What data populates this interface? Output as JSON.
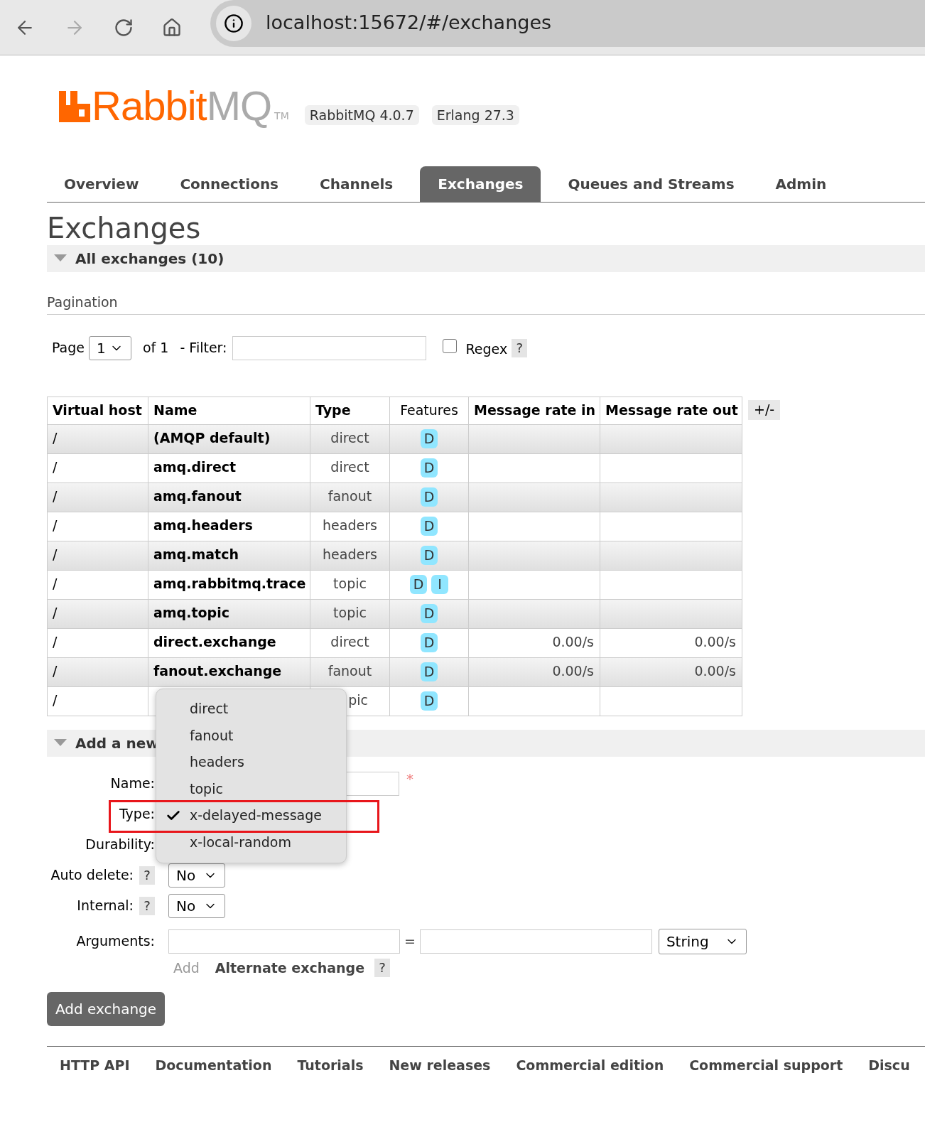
{
  "browser": {
    "url": "localhost:15672/#/exchanges"
  },
  "header": {
    "logo_primary": "Rabbit",
    "logo_secondary": "MQ",
    "trademark": "TM",
    "versions": [
      "RabbitMQ 4.0.7",
      "Erlang 27.3"
    ]
  },
  "tabs": [
    {
      "label": "Overview",
      "selected": false
    },
    {
      "label": "Connections",
      "selected": false
    },
    {
      "label": "Channels",
      "selected": false
    },
    {
      "label": "Exchanges",
      "selected": true
    },
    {
      "label": "Queues and Streams",
      "selected": false
    },
    {
      "label": "Admin",
      "selected": false
    }
  ],
  "page_title": "Exchanges",
  "all_section": {
    "title": "All exchanges (10)",
    "expanded": true
  },
  "pagination": {
    "heading": "Pagination",
    "page_label": "Page",
    "page_value": "1",
    "of_label": "of 1",
    "filter_label": "- Filter:",
    "regex_label": "Regex",
    "regex_checked": false,
    "help": "?"
  },
  "table": {
    "columns": [
      {
        "label": "Virtual host",
        "bold": true
      },
      {
        "label": "Name",
        "bold": true
      },
      {
        "label": "Type",
        "bold": true
      },
      {
        "label": "Features",
        "bold": false
      },
      {
        "label": "Message rate in",
        "bold": true
      },
      {
        "label": "Message rate out",
        "bold": true
      }
    ],
    "toggle": "+/-",
    "rows": [
      {
        "vhost": "/",
        "name": "(AMQP default)",
        "type": "direct",
        "features": [
          "D"
        ]
      },
      {
        "vhost": "/",
        "name": "amq.direct",
        "type": "direct",
        "features": [
          "D"
        ]
      },
      {
        "vhost": "/",
        "name": "amq.fanout",
        "type": "fanout",
        "features": [
          "D"
        ]
      },
      {
        "vhost": "/",
        "name": "amq.headers",
        "type": "headers",
        "features": [
          "D"
        ]
      },
      {
        "vhost": "/",
        "name": "amq.match",
        "type": "headers",
        "features": [
          "D"
        ]
      },
      {
        "vhost": "/",
        "name": "amq.rabbitmq.trace",
        "type": "topic",
        "features": [
          "D",
          "I"
        ]
      },
      {
        "vhost": "/",
        "name": "amq.topic",
        "type": "topic",
        "features": [
          "D"
        ]
      },
      {
        "vhost": "/",
        "name": "direct.exchange",
        "type": "direct",
        "features": [
          "D"
        ],
        "rate_in": "0.00/s",
        "rate_out": "0.00/s"
      },
      {
        "vhost": "/",
        "name": "fanout.exchange",
        "type": "fanout",
        "features": [
          "D"
        ],
        "rate_in": "0.00/s",
        "rate_out": "0.00/s"
      },
      {
        "vhost": "/",
        "type": "pic",
        "features": [
          "D"
        ]
      }
    ]
  },
  "add_section": {
    "title": "Add a new",
    "expanded": true
  },
  "form": {
    "name_label": "Name:",
    "required_mark": "*",
    "type_label": "Type:",
    "durability_label": "Durability:",
    "auto_delete": {
      "label": "Auto delete:",
      "help": "?",
      "value": "No"
    },
    "internal": {
      "label": "Internal:",
      "help": "?",
      "value": "No"
    },
    "arguments": {
      "label": "Arguments:",
      "equals": "=",
      "value_type": "String",
      "add_link": "Add",
      "alternate": "Alternate exchange",
      "help": "?"
    },
    "submit": "Add exchange"
  },
  "type_menu": {
    "options": [
      {
        "label": "direct",
        "selected": false
      },
      {
        "label": "fanout",
        "selected": false
      },
      {
        "label": "headers",
        "selected": false
      },
      {
        "label": "topic",
        "selected": false
      },
      {
        "label": "x-delayed-message",
        "selected": true
      },
      {
        "label": "x-local-random",
        "selected": false
      }
    ]
  },
  "footer": {
    "links": [
      "HTTP API",
      "Documentation",
      "Tutorials",
      "New releases",
      "Commercial edition",
      "Commercial support",
      "Discu"
    ]
  }
}
